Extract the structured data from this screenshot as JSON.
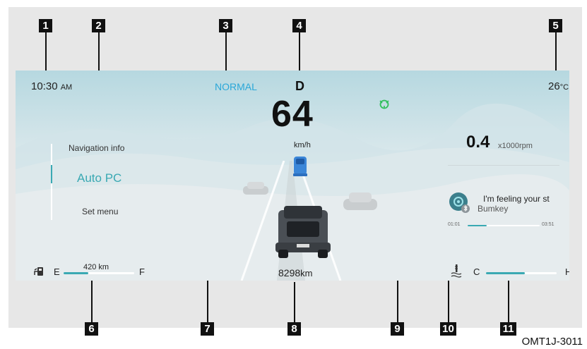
{
  "callouts": [
    "1",
    "2",
    "3",
    "4",
    "5",
    "6",
    "7",
    "8",
    "9",
    "10",
    "11"
  ],
  "status_bar": {
    "time": "10:30",
    "time_suffix": "AM",
    "drive_mode": "NORMAL",
    "gear": "D",
    "temperature": "26",
    "temperature_unit": "°C"
  },
  "menu": {
    "items": [
      "Navigation info",
      "Auto PC",
      "Set menu"
    ],
    "selected": "Auto PC"
  },
  "speed": {
    "value": "64",
    "unit": "km/h"
  },
  "rpm": {
    "value": "0.4",
    "unit": "x1000rpm"
  },
  "media": {
    "title": "I'm feeling your st",
    "artist": "Bumkey",
    "elapsed": "01:01",
    "duration": "03:51",
    "progress": 0.26
  },
  "fuel": {
    "empty_label": "E",
    "full_label": "F",
    "range": "420",
    "range_unit": "km",
    "level": 0.35
  },
  "odometer": {
    "value": "8298",
    "unit": "km"
  },
  "coolant": {
    "cold_label": "C",
    "hot_label": "H",
    "level": 0.55
  },
  "icons": {
    "fuel": "fuel-pump-icon",
    "coolant": "coolant-temperature-icon",
    "adas": "steering-assist-icon",
    "media": "bluetooth-music-icon"
  },
  "colors": {
    "accent": "#3aa9b3",
    "drive_mode": "#2aa7d8",
    "adas_green": "#2fbf5a"
  },
  "figure_code": "OMT1J-3011"
}
